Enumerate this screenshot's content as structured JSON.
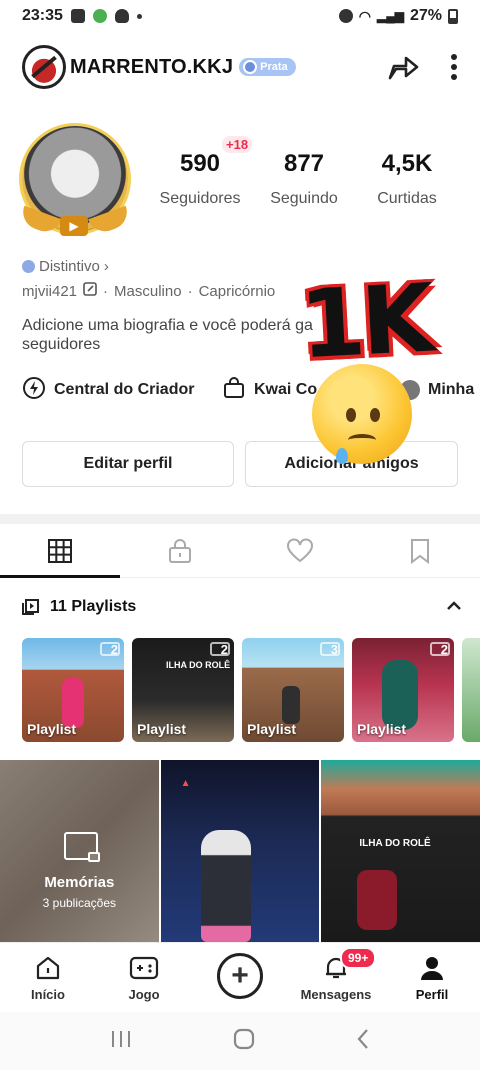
{
  "status_bar": {
    "time": "23:35",
    "battery": "27%"
  },
  "header": {
    "username": "MARRENTO.KKJ",
    "rank_badge": "Prata"
  },
  "stats": {
    "followers_new": "+18",
    "followers": {
      "value": "590",
      "label": "Seguidores"
    },
    "following": {
      "value": "877",
      "label": "Seguindo"
    },
    "likes": {
      "value": "4,5K",
      "label": "Curtidas"
    }
  },
  "profile": {
    "badge_link": "Distintivo",
    "handle": "mjvii421",
    "gender": "Masculino",
    "sign": "Capricórnio",
    "bio": "Adicione uma biografia e você poderá ga… seguidores",
    "bio_line1": "Adicione uma biografia e você poderá ga",
    "bio_line2": "seguidores"
  },
  "quick_links": {
    "creator": "Central do Criador",
    "shop": "Kwai Co",
    "mine": "Minha"
  },
  "buttons": {
    "edit_profile": "Editar perfil",
    "add_friends": "Adicionar amigos"
  },
  "overlay": {
    "sticker_text": "1K"
  },
  "playlists": {
    "title": "11 Playlists",
    "items": [
      {
        "label": "Playlist",
        "count": "2"
      },
      {
        "label": "Playlist",
        "count": "2"
      },
      {
        "label": "Playlist",
        "count": "3"
      },
      {
        "label": "Playlist",
        "count": "2"
      }
    ]
  },
  "posts": {
    "memories_title": "Memórias",
    "memories_sub": "3 publicações",
    "video3_title": "ILHA DO ROLÊ"
  },
  "bottom_nav": {
    "home": "Início",
    "game": "Jogo",
    "messages": "Mensagens",
    "messages_badge": "99+",
    "profile": "Perfil"
  }
}
